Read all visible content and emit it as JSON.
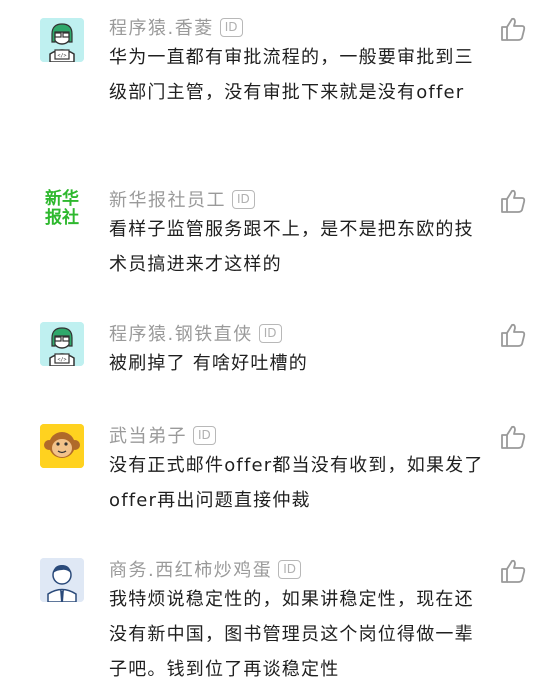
{
  "comments": [
    {
      "name": "程序猿.香菱",
      "badge": "ID",
      "text": "华为一直都有审批流程的，一般要审批到三级部门主管，没有审批下来就是没有offer",
      "avatar": "programmer"
    },
    {
      "name": "新华报社员工",
      "badge": "ID",
      "text": "看样子监管服务跟不上，是不是把东欧的技术员搞进来才这样的",
      "avatar": "xinhua",
      "avatar_text": "新华报社"
    },
    {
      "name": "程序猿.钢铁直侠",
      "badge": "ID",
      "text": "被刷掉了 有啥好吐槽的",
      "avatar": "programmer"
    },
    {
      "name": "武当弟子",
      "badge": "ID",
      "text": "没有正式邮件offer都当没有收到，如果发了offer再出问题直接仲裁",
      "avatar": "monkey"
    },
    {
      "name": "商务.西红柿炒鸡蛋",
      "badge": "ID",
      "text": "我特烦说稳定性的，如果讲稳定性，现在还没有新中国，图书管理员这个岗位得做一辈子吧。钱到位了再谈稳定性",
      "avatar": "business"
    }
  ],
  "colors": {
    "name": "#9a9a9a",
    "body": "#1f1f1f",
    "xinhua_green": "#2eb82e",
    "programmer_bg": "#bff0f0",
    "monkey_bg": "#ffd21f",
    "business_bg": "#dfe8f5"
  },
  "icons": {
    "like": "thumbs-up-icon"
  }
}
